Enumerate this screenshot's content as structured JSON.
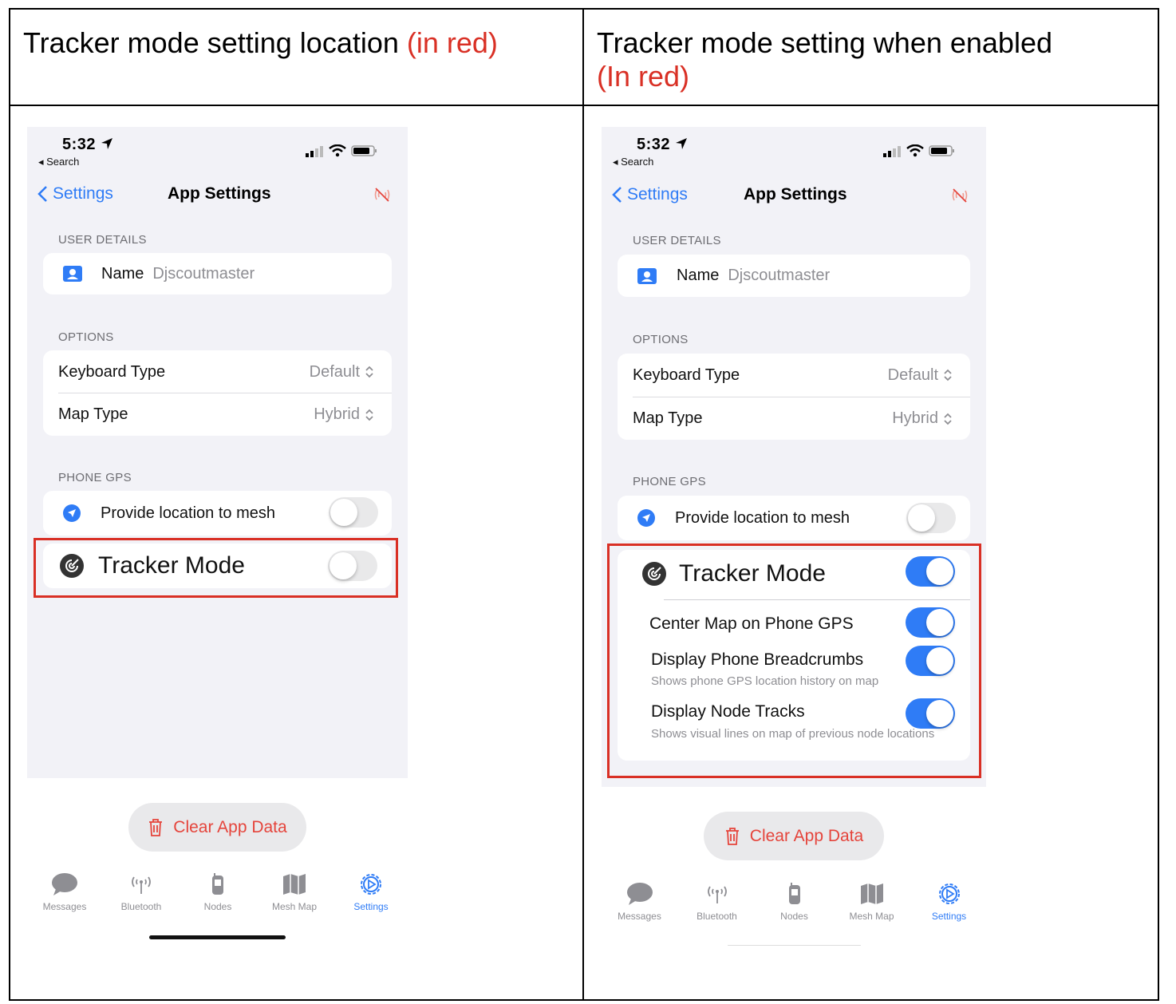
{
  "header": {
    "left_title": "Tracker mode setting location ",
    "left_highlight": "(in red)",
    "right_title": "Tracker mode setting when enabled",
    "right_highlight": "(In red)"
  },
  "phone": {
    "time": "5:32",
    "back_to_app": "Search",
    "nav_back_label": "Settings",
    "nav_title": "App Settings",
    "user_details_label": "USER DETAILS",
    "name_label": "Name",
    "name_value": "Djscoutmaster",
    "options_label": "OPTIONS",
    "keyboard_type_label": "Keyboard Type",
    "keyboard_type_value": "Default",
    "map_type_label": "Map Type",
    "map_type_value": "Hybrid",
    "phone_gps_label": "PHONE GPS",
    "provide_location_label": "Provide location to mesh",
    "tracker_mode_label": "Tracker Mode",
    "center_map_label": "Center Map on Phone GPS",
    "breadcrumbs_label": "Display Phone Breadcrumbs",
    "breadcrumbs_sub": "Shows phone GPS location history on map",
    "node_tracks_label": "Display Node Tracks",
    "node_tracks_sub": "Shows visual lines on map of previous node locations",
    "clear_button": "Clear App Data",
    "tabs": [
      {
        "label": "Messages",
        "icon": "speech-bubble-icon"
      },
      {
        "label": "Bluetooth",
        "icon": "antenna-icon"
      },
      {
        "label": "Nodes",
        "icon": "radio-device-icon"
      },
      {
        "label": "Mesh Map",
        "icon": "map-icon"
      },
      {
        "label": "Settings",
        "icon": "gear-icon"
      }
    ]
  },
  "left_state": {
    "provide_location": false,
    "tracker_mode": false
  },
  "right_state": {
    "provide_location": false,
    "tracker_mode": true,
    "center_map": true,
    "breadcrumbs": true,
    "node_tracks": true
  },
  "colors": {
    "accent": "#2f7cf6",
    "highlight_red": "#d93025",
    "destructive": "#e5443b"
  }
}
